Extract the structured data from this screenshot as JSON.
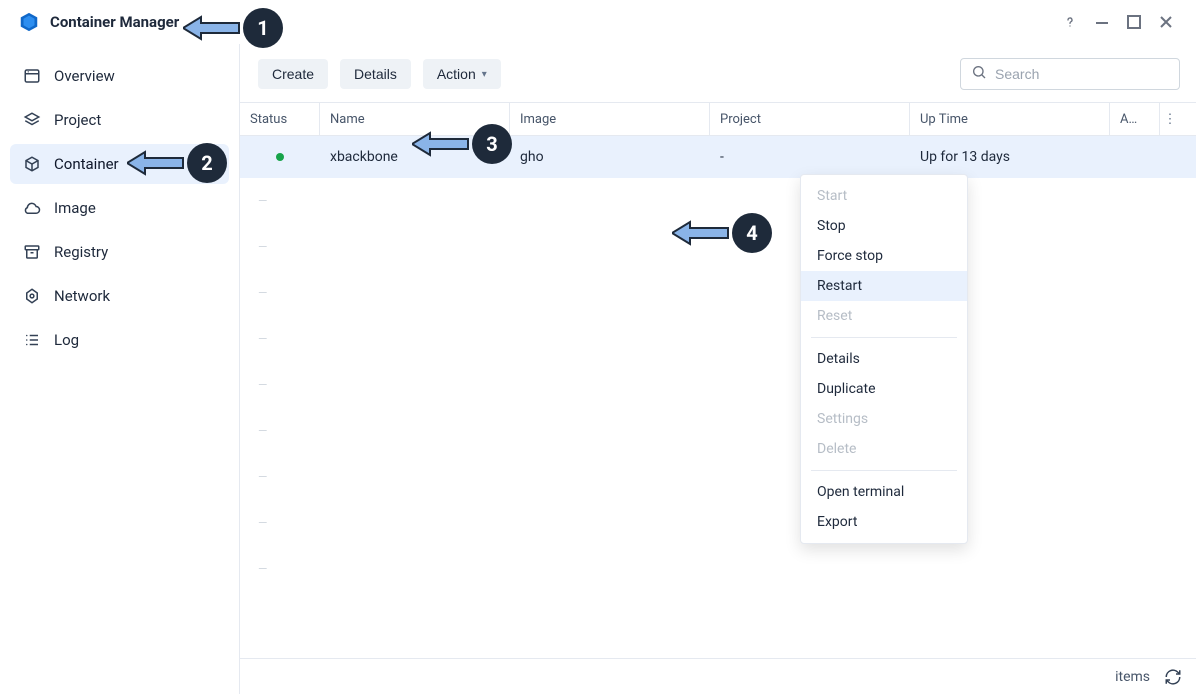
{
  "app": {
    "title": "Container Manager"
  },
  "sidebar": {
    "items": [
      {
        "label": "Overview"
      },
      {
        "label": "Project"
      },
      {
        "label": "Container",
        "active": true
      },
      {
        "label": "Image"
      },
      {
        "label": "Registry"
      },
      {
        "label": "Network"
      },
      {
        "label": "Log"
      }
    ]
  },
  "toolbar": {
    "create": "Create",
    "details": "Details",
    "action": "Action"
  },
  "search": {
    "placeholder": "Search"
  },
  "table": {
    "headers": {
      "status": "Status",
      "name": "Name",
      "image": "Image",
      "project": "Project",
      "uptime": "Up Time",
      "extra": "A…"
    },
    "rows": [
      {
        "status": "running",
        "name": "xbackbone",
        "image": "gho",
        "project": "-",
        "uptime": "Up for 13 days"
      }
    ]
  },
  "context_menu": {
    "start": "Start",
    "stop": "Stop",
    "force_stop": "Force stop",
    "restart": "Restart",
    "reset": "Reset",
    "details": "Details",
    "duplicate": "Duplicate",
    "settings": "Settings",
    "delete": "Delete",
    "open_terminal": "Open terminal",
    "export": "Export"
  },
  "footer": {
    "items_label": "items"
  },
  "annotations": {
    "a1": "1",
    "a2": "2",
    "a3": "3",
    "a4": "4"
  }
}
